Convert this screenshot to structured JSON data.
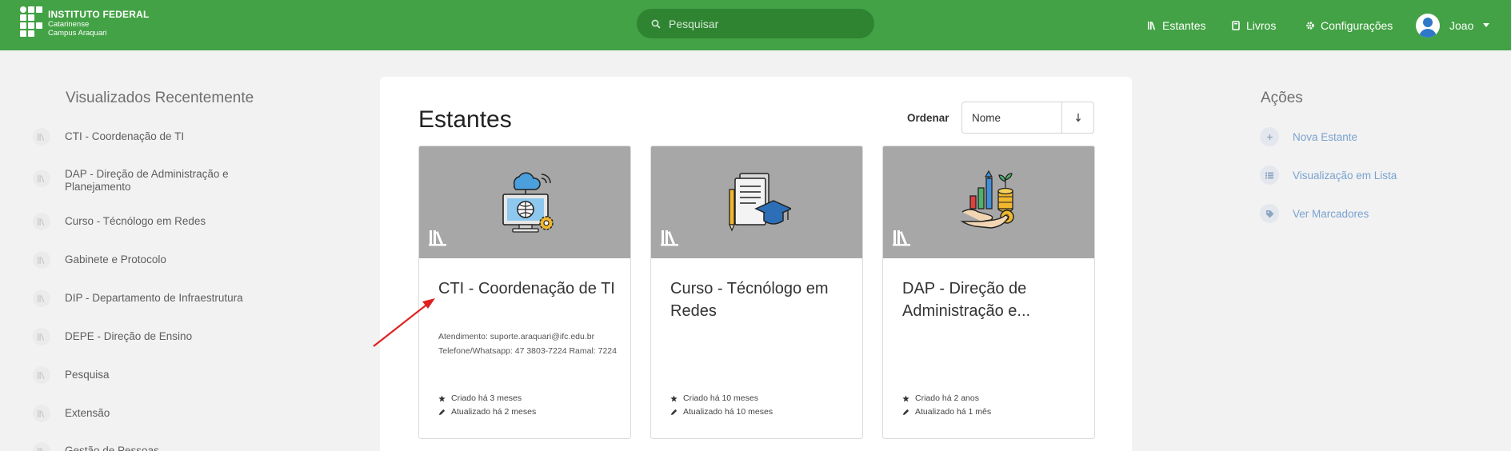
{
  "header": {
    "logo": {
      "line1": "INSTITUTO FEDERAL",
      "line2": "Catarinense",
      "line3": "Campus Araquari"
    },
    "search": {
      "placeholder": "Pesquisar",
      "icon": "search-icon"
    },
    "nav": {
      "shelves": "Estantes",
      "books": "Livros",
      "settings": "Configurações",
      "user": "Joao"
    },
    "colors": {
      "bar": "#43a245",
      "search_bg": "#2f8432"
    }
  },
  "recent": {
    "title": "Visualizados Recentemente",
    "items": [
      {
        "label": "CTI - Coordenação de TI"
      },
      {
        "label": "DAP - Direção de Administração e Planejamento"
      },
      {
        "label": "Curso - Técnólogo em Redes"
      },
      {
        "label": "Gabinete e Protocolo"
      },
      {
        "label": "DIP - Departamento de Infraestrutura"
      },
      {
        "label": "DEPE - Direção de Ensino"
      },
      {
        "label": "Pesquisa"
      },
      {
        "label": "Extensão"
      },
      {
        "label": "Gestão de Pessoas"
      }
    ]
  },
  "main": {
    "title": "Estantes",
    "sort": {
      "label": "Ordenar",
      "value": "Nome",
      "direction_icon": "arrow-down-icon"
    },
    "cards": [
      {
        "title": "CTI - Coordenação de TI",
        "desc1": "Atendimento: suporte.araquari@ifc.edu.br",
        "desc2": "Telefone/Whatsapp: 47 3803-7224 Ramal: 7224",
        "created": "Criado há 3 meses",
        "updated": "Atualizado há 2 meses",
        "art": "computer-cloud-icon"
      },
      {
        "title": "Curso - Técnólogo em Redes",
        "desc1": "",
        "desc2": "",
        "created": "Criado há 10 meses",
        "updated": "Atualizado há 10 meses",
        "art": "document-graduation-icon"
      },
      {
        "title": "DAP - Direção de Administração e...",
        "desc1": "",
        "desc2": "",
        "created": "Criado há 2 anos",
        "updated": "Atualizado há 1 mês",
        "art": "growth-coins-icon"
      }
    ]
  },
  "actions": {
    "title": "Ações",
    "items": [
      {
        "label": "Nova Estante",
        "icon": "plus-icon"
      },
      {
        "label": "Visualização em Lista",
        "icon": "list-icon"
      },
      {
        "label": "Ver Marcadores",
        "icon": "tag-icon"
      }
    ],
    "link_color": "#7aa2cf"
  }
}
